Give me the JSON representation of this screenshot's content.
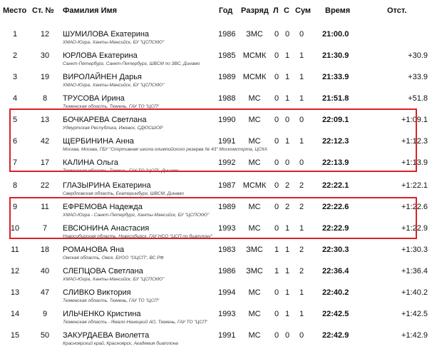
{
  "headers": {
    "place": "Место",
    "bib": "Ст. №",
    "name": "Фамилия Имя",
    "year": "Год",
    "rank": "Разряд",
    "l": "Л",
    "s": "С",
    "sum": "Сум",
    "time": "Время",
    "behind": "Отст."
  },
  "rows": [
    {
      "place": "1",
      "bib": "12",
      "name": "ШУМИЛОВА Екатерина",
      "sub": "ХМАО-Югра, Ханты-Мансийск, БУ \"ЦСПСКЮ\"",
      "year": "1986",
      "rank": "ЗМС",
      "l": "0",
      "s": "0",
      "sum": "0",
      "time": "21:00.0",
      "behind": ""
    },
    {
      "place": "2",
      "bib": "30",
      "name": "ЮРЛОВА Екатерина",
      "sub": "Санкт-Петербург, Санкт-Петербург, ШВСМ по ЗВС, Динамо",
      "year": "1985",
      "rank": "МСМК",
      "l": "0",
      "s": "1",
      "sum": "1",
      "time": "21:30.9",
      "behind": "+30.9"
    },
    {
      "place": "3",
      "bib": "19",
      "name": "ВИРОЛАЙНЕН Дарья",
      "sub": "ХМАО-Югра, Ханты-Мансийск, БУ \"ЦСПСКЮ\"",
      "year": "1989",
      "rank": "МСМК",
      "l": "0",
      "s": "1",
      "sum": "1",
      "time": "21:33.9",
      "behind": "+33.9"
    },
    {
      "place": "4",
      "bib": "8",
      "name": "ТРУСОВА Ирина",
      "sub": "Тюменская область, Тюмень, ГАУ ТО \"ЦСП\"",
      "year": "1988",
      "rank": "МС",
      "l": "0",
      "s": "1",
      "sum": "1",
      "time": "21:51.8",
      "behind": "+51.8"
    },
    {
      "place": "5",
      "bib": "13",
      "name": "БОЧКАРЕВА Светлана",
      "sub": "Удмуртская Республика, Ижевск, СДЮСШОР",
      "year": "1990",
      "rank": "МС",
      "l": "0",
      "s": "0",
      "sum": "0",
      "time": "22:09.1",
      "behind": "+1:09.1"
    },
    {
      "place": "6",
      "bib": "42",
      "name": "ЩЕРБИНИНА Анна",
      "sub": "Москва, Москва, ГБУ \"Спортивная школа олимпийского резерва № 43\" Москомспорта, ЦСКА",
      "year": "1991",
      "rank": "МС",
      "l": "0",
      "s": "1",
      "sum": "1",
      "time": "22:12.3",
      "behind": "+1:12.3"
    },
    {
      "place": "7",
      "bib": "17",
      "name": "КАЛИНА Ольга",
      "sub": "Тюменская область, Тюмень, ГАУ ТО \"ЦСП\", Динамо",
      "year": "1992",
      "rank": "МС",
      "l": "0",
      "s": "0",
      "sum": "0",
      "time": "22:13.9",
      "behind": "+1:13.9"
    },
    {
      "place": "8",
      "bib": "22",
      "name": "ГЛАЗЫРИНА Екатерина",
      "sub": "Свердловская область, Екатеринбург, ШВСМ, Динамо",
      "year": "1987",
      "rank": "МСМК",
      "l": "0",
      "s": "2",
      "sum": "2",
      "time": "22:22.1",
      "behind": "+1:22.1"
    },
    {
      "place": "9",
      "bib": "11",
      "name": "ЕФРЕМОВА Надежда",
      "sub": "ХМАО-Югра - Санкт-Петербург, Ханты-Мансийск, БУ \"ЦСПСКЮ\"",
      "year": "1989",
      "rank": "МС",
      "l": "0",
      "s": "2",
      "sum": "2",
      "time": "22:22.6",
      "behind": "+1:22.6"
    },
    {
      "place": "10",
      "bib": "7",
      "name": "ЕВСЮНИНА Анастасия",
      "sub": "Новосибирская область, Новосибирск, ГАУ НСО \"ЦСП по биатлону\"",
      "year": "1993",
      "rank": "МС",
      "l": "0",
      "s": "1",
      "sum": "1",
      "time": "22:22.9",
      "behind": "+1:22.9"
    },
    {
      "place": "11",
      "bib": "18",
      "name": "РОМАНОВА Яна",
      "sub": "Омская область, Омск, БУОО \"ОЦСП\", ВС РФ",
      "year": "1983",
      "rank": "ЗМС",
      "l": "1",
      "s": "1",
      "sum": "2",
      "time": "22:30.3",
      "behind": "+1:30.3"
    },
    {
      "place": "12",
      "bib": "40",
      "name": "СЛЕПЦОВА Светлана",
      "sub": "ХМАО-Югра, Ханты-Мансийск, БУ \"ЦСПСКЮ\"",
      "year": "1986",
      "rank": "ЗМС",
      "l": "1",
      "s": "1",
      "sum": "2",
      "time": "22:36.4",
      "behind": "+1:36.4"
    },
    {
      "place": "13",
      "bib": "47",
      "name": "СЛИВКО Виктория",
      "sub": "Тюменская область, Тюмень, ГАУ ТО \"ЦСП\"",
      "year": "1994",
      "rank": "МС",
      "l": "0",
      "s": "1",
      "sum": "1",
      "time": "22:40.2",
      "behind": "+1:40.2"
    },
    {
      "place": "14",
      "bib": "9",
      "name": "ИЛЬЧЕНКО Кристина",
      "sub": "Тюменская область - Ямало-Ненецкий АО, Тюмень, ГАУ ТО \"ЦСП\"",
      "year": "1993",
      "rank": "МС",
      "l": "0",
      "s": "1",
      "sum": "1",
      "time": "22:42.5",
      "behind": "+1:42.5"
    },
    {
      "place": "15",
      "bib": "50",
      "name": "ЗАКУРДАЕВА Виолетта",
      "sub": "Красноярский край, Красноярск, Академия биатлона",
      "year": "1991",
      "rank": "МС",
      "l": "0",
      "s": "0",
      "sum": "0",
      "time": "22:42.9",
      "behind": "+1:42.9"
    }
  ],
  "colors": {
    "highlight_border": "#d8222a",
    "text": "#111111",
    "subtext": "#444444"
  }
}
